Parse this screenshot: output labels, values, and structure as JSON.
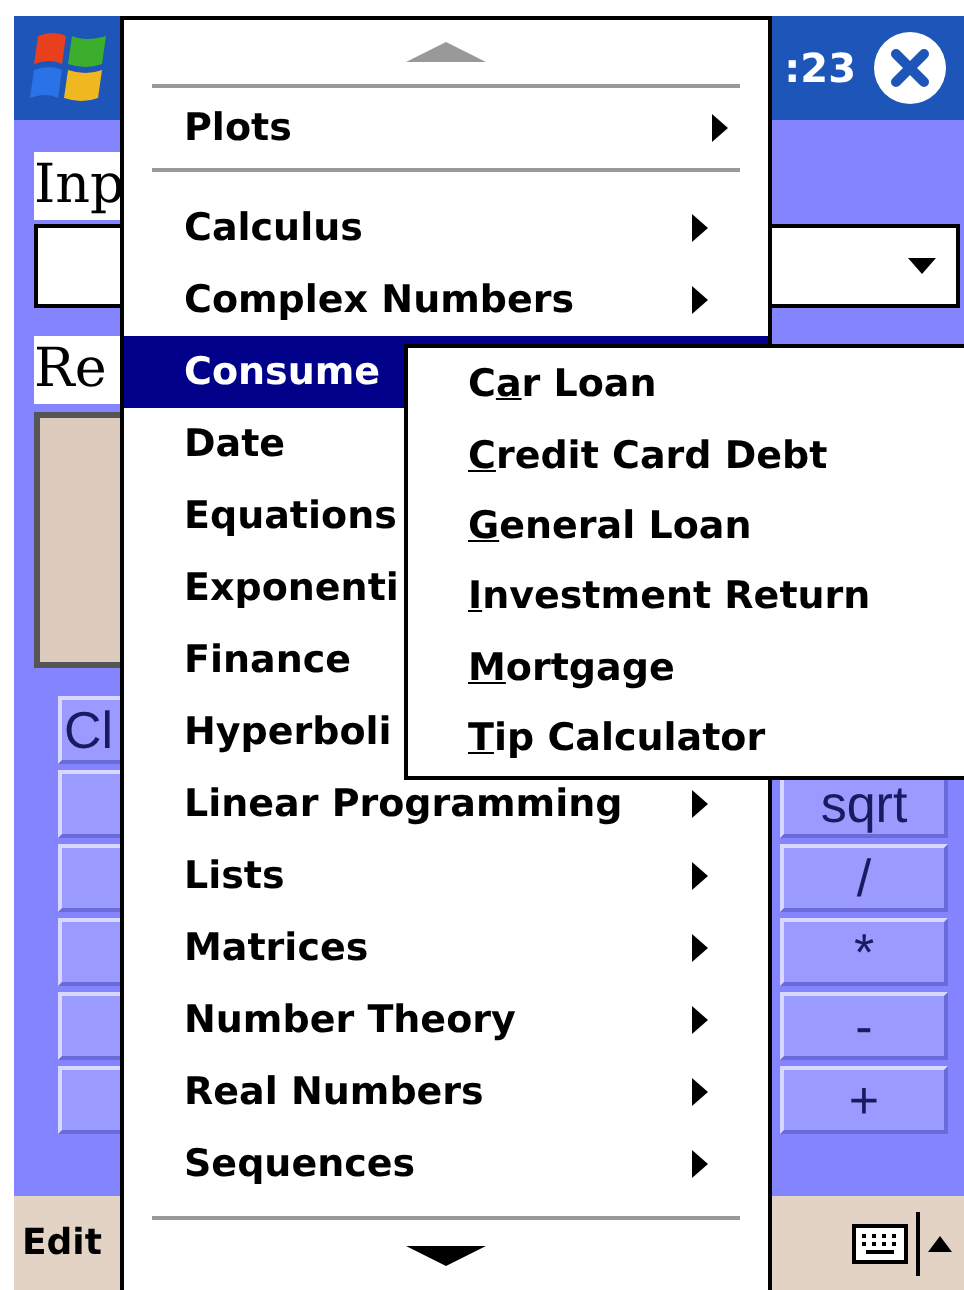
{
  "title_bar": {
    "clock": ":23"
  },
  "form": {
    "input_label": "Inp",
    "result_label": "Re",
    "clear_key": "Cl",
    "keys": [
      "sqrt",
      "/",
      "*",
      "-",
      "+"
    ]
  },
  "menu": {
    "top_items": [
      {
        "label": "Plots",
        "arrow": true
      }
    ],
    "items": [
      {
        "label": "Calculus",
        "arrow": true,
        "selected": false
      },
      {
        "label": "Complex Numbers",
        "arrow": true,
        "selected": false
      },
      {
        "label": "Consume",
        "arrow": false,
        "selected": true
      },
      {
        "label": "Date",
        "arrow": false,
        "selected": false
      },
      {
        "label": "Equations",
        "arrow": false,
        "selected": false
      },
      {
        "label": "Exponenti",
        "arrow": false,
        "selected": false
      },
      {
        "label": "Finance",
        "arrow": false,
        "selected": false
      },
      {
        "label": "Hyperboli",
        "arrow": false,
        "selected": false
      },
      {
        "label": "Linear Programming",
        "arrow": true,
        "selected": false
      },
      {
        "label": "Lists",
        "arrow": true,
        "selected": false
      },
      {
        "label": "Matrices",
        "arrow": true,
        "selected": false
      },
      {
        "label": "Number Theory",
        "arrow": true,
        "selected": false
      },
      {
        "label": "Real Numbers",
        "arrow": true,
        "selected": false
      },
      {
        "label": "Sequences",
        "arrow": true,
        "selected": false
      }
    ]
  },
  "submenu": [
    {
      "before": "C",
      "key": "a",
      "after": "r Loan"
    },
    {
      "key": "C",
      "after": "redit Card Debt"
    },
    {
      "key": "G",
      "after": "eneral Loan"
    },
    {
      "key": "I",
      "after": "nvestment Return"
    },
    {
      "key": "M",
      "after": "ortgage"
    },
    {
      "key": "T",
      "after": "ip Calculator"
    }
  ],
  "bottom_bar": {
    "menu_label": "Edit"
  }
}
